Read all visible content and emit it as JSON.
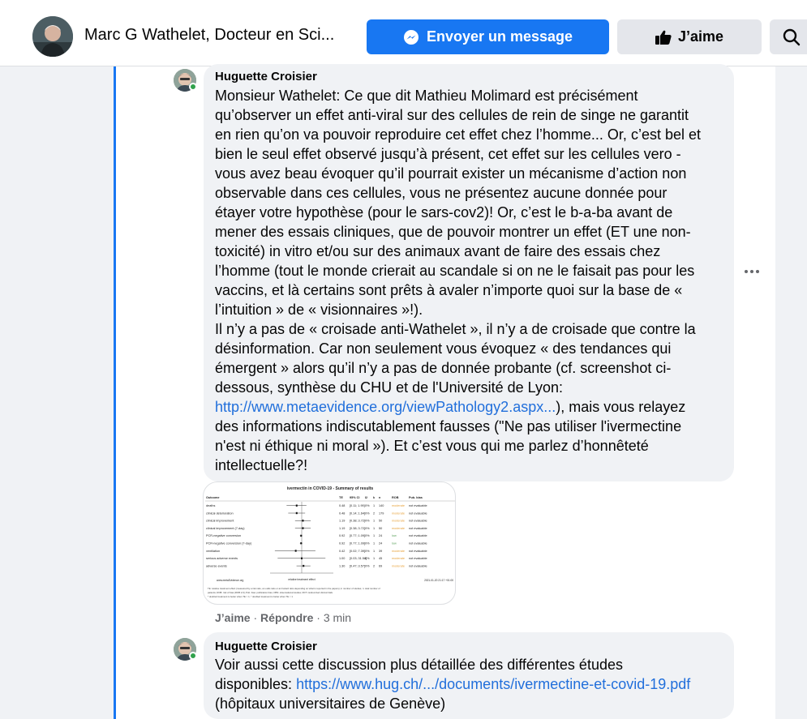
{
  "header": {
    "page_name": "Marc G Wathelet, Docteur en Sci...",
    "message_button": "Envoyer un message",
    "like_button": "J’aime"
  },
  "comments": [
    {
      "author": "Huguette Croisier",
      "lines": [
        "Monsieur Wathelet: Ce que dit Mathieu Molimard est précisément",
        "qu’observer un effet anti-viral sur des cellules de rein de singe ne garantit",
        "en rien qu’on va pouvoir reproduire cet effet chez l’homme... Or, c’est bel et",
        "bien le seul effet observé jusqu’à présent, cet effet sur les cellules vero -",
        "vous avez beau évoquer qu’il pourrait exister un mécanisme d’action non",
        "observable dans ces cellules, vous ne présentez aucune donnée pour",
        "étayer votre hypothèse (pour le sars-cov2)! Or, c’est le b-a-ba avant de",
        "mener des essais cliniques, que de pouvoir montrer un effet (ET une non-",
        "toxicité) in vitro et/ou sur des animaux avant de faire des essais chez",
        "l’homme (tout le monde crierait au scandale si on ne le faisait pas pour les",
        "vaccins, et là certains sont prêts à avaler n’importe quoi sur la base de «",
        "l’intuition » de « visionnaires »!).",
        "Il n’y a pas de « croisade anti-Wathelet », il n’y a de croisade que contre la",
        "désinformation. Car non seulement vous évoquez « des tendances qui",
        "émergent » alors qu’il n’y a pas de donnée probante (cf. screenshot ci-",
        "dessous, synthèse du CHU et de l'Université de Lyon:"
      ],
      "link": "http://www.metaevidence.org/viewPathology2.aspx...",
      "link_suffix": "), mais vous relayez",
      "lines_after": [
        "des informations indiscutablement fausses (\"Ne pas utiliser l'ivermectine",
        "n'est ni éthique ni moral »). Et c’est vous qui me parlez d’honnêteté",
        "intellectuelle?!"
      ],
      "like_action": "J’aime",
      "reply_action": "Répondre",
      "time": "3 min"
    },
    {
      "author": "Huguette Croisier",
      "line1": "Voir aussi cette discussion plus détaillée des différentes études",
      "line2_prefix": "disponibles: ",
      "link": "https://www.hug.ch/.../documents/ivermectine-et-covid-19.pdf",
      "line3": "(hôpitaux universitaires de Genève)"
    }
  ],
  "attachment_table": {
    "title": "ivermectin in COVID-19 - Summary of results",
    "columns": [
      "Outcome",
      "TE",
      "95% CI",
      "I2",
      "k",
      "n",
      "ROB",
      "Pub. bias"
    ],
    "rows": [
      [
        "deaths",
        "0.48",
        "[0.11; 1.99]",
        "0%",
        "1",
        "140",
        "moderate",
        "not evaluable"
      ],
      [
        "clinical deterioration",
        "0.48",
        "[0.14; 1.64]",
        "0%",
        "2",
        "179",
        "moderate",
        "not evaluable"
      ],
      [
        "clinical improvement",
        "1.19",
        "[0.38; 3.72]",
        "0%",
        "1",
        "50",
        "moderate",
        "not evaluable"
      ],
      [
        "clinical improvement (7-day)",
        "1.19",
        "[0.38; 3.72]",
        "0%",
        "1",
        "50",
        "moderate",
        "not evaluable"
      ],
      [
        "PCR-negative conversion",
        "0.92",
        "[0.77; 1.09]",
        "0%",
        "1",
        "24",
        "low",
        "not evaluable"
      ],
      [
        "PCR-negative conversion (7-day)",
        "0.92",
        "[0.77; 1.09]",
        "0%",
        "1",
        "24",
        "low",
        "not evaluable"
      ],
      [
        "ventilation",
        "0.42",
        "[0.02; 7.39]",
        "0%",
        "1",
        "39",
        "moderate",
        "not evaluable"
      ],
      [
        "serious adverse events",
        "1.00",
        "[0.03; 31.58]",
        "0%",
        "1",
        "45",
        "moderate",
        "not evaluable"
      ],
      [
        "adverse events",
        "1.30",
        "[0.47; 3.57]",
        "0%",
        "2",
        "69",
        "moderate",
        "not evaluable"
      ]
    ],
    "axis_label": "relative treatment effect",
    "site": "www.metaEvidence.org",
    "date": "2021-01-20 21:17 +01:00",
    "footnote1": "TE: relative treatment effect (measured by a risk ratio, an odds ratio or an hazard ratio depending on what is reported in the papers); k: number of studies; n: total number of",
    "footnote2": "patients; ROB: risk of bias (ROB 2.0); Pub. bias: publication bias; OBS: observational studies; RCT: randomized clinical trials",
    "footnote3": "* doubled treatment is better when TE > 1; ° doubled treatment is better when TE < 1"
  },
  "colors": {
    "accent": "#1877f2",
    "link": "#216fdb",
    "bubble": "#f0f2f5",
    "online": "#31a24c",
    "rob_moderate": "#e8a33d",
    "rob_low": "#5aa05a"
  },
  "icons": [
    "messenger-icon",
    "thumbs-up-icon",
    "search-icon",
    "more-options-icon"
  ]
}
